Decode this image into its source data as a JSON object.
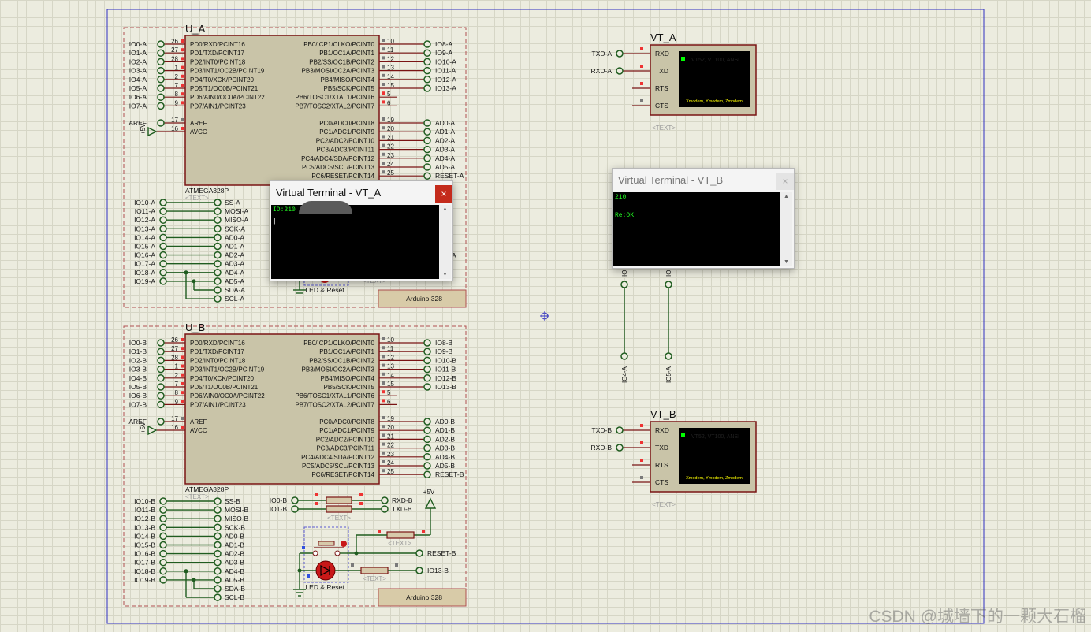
{
  "window": {
    "title": "Virtual Terminal - VT_A",
    "close_glyph": "×"
  },
  "colors": {
    "wire": "#1f5c1f",
    "chip_fill": "#c9c4a8",
    "chip_border": "#7a1414",
    "dash": "#b05050",
    "sheet_border": "#3030c0",
    "pin_red": "#e33",
    "pin_gray": "#7a7a7a"
  },
  "chip_a": {
    "ref": "U_A",
    "part": "ATMEGA328P",
    "text": "<TEXT>",
    "left_pins": [
      {
        "num": "26",
        "name": "PD0/RXD/PCINT16",
        "net": "IO0-A"
      },
      {
        "num": "27",
        "name": "PD1/TXD/PCINT17",
        "net": "IO1-A"
      },
      {
        "num": "28",
        "name": "PD2/INT0/PCINT18",
        "net": "IO2-A"
      },
      {
        "num": "1",
        "name": "PD3/INT1/OC2B/PCINT19",
        "net": "IO3-A"
      },
      {
        "num": "2",
        "name": "PD4/T0/XCK/PCINT20",
        "net": "IO4-A"
      },
      {
        "num": "7",
        "name": "PD5/T1/OC0B/PCINT21",
        "net": "IO5-A"
      },
      {
        "num": "8",
        "name": "PD6/AIN0/OC0A/PCINT22",
        "net": "IO6-A"
      },
      {
        "num": "9",
        "name": "PD7/AIN1/PCINT23",
        "net": "IO7-A"
      }
    ],
    "aref": {
      "num": "17",
      "name": "AREF",
      "net": "AREF"
    },
    "avcc": {
      "num": "16",
      "name": "AVCC",
      "net": "+5V"
    },
    "right_top": [
      {
        "num": "10",
        "name": "PB0/ICP1/CLKO/PCINT0",
        "net": "IO8-A"
      },
      {
        "num": "11",
        "name": "PB1/OC1A/PCINT1",
        "net": "IO9-A"
      },
      {
        "num": "12",
        "name": "PB2/SS/OC1B/PCINT2",
        "net": "IO10-A"
      },
      {
        "num": "13",
        "name": "PB3/MOSI/OC2A/PCINT3",
        "net": "IO11-A"
      },
      {
        "num": "14",
        "name": "PB4/MISO/PCINT4",
        "net": "IO12-A"
      },
      {
        "num": "15",
        "name": "PB5/SCK/PCINT5",
        "net": "IO13-A"
      },
      {
        "num": "5",
        "name": "PB6/TOSC1/XTAL1/PCINT6",
        "net": ""
      },
      {
        "num": "6",
        "name": "PB7/TOSC2/XTAL2/PCINT7",
        "net": ""
      }
    ],
    "right_bottom": [
      {
        "num": "19",
        "name": "PC0/ADC0/PCINT8",
        "net": "AD0-A"
      },
      {
        "num": "20",
        "name": "PC1/ADC1/PCINT9",
        "net": "AD1-A"
      },
      {
        "num": "21",
        "name": "PC2/ADC2/PCINT10",
        "net": "AD2-A"
      },
      {
        "num": "22",
        "name": "PC3/ADC3/PCINT11",
        "net": "AD3-A"
      },
      {
        "num": "23",
        "name": "PC4/ADC4/SDA/PCINT12",
        "net": "AD4-A"
      },
      {
        "num": "24",
        "name": "PC5/ADC5/SCL/PCINT13",
        "net": "AD5-A"
      },
      {
        "num": "25",
        "name": "PC6/RESET/PCINT14",
        "net": "RESET-A"
      }
    ],
    "header": [
      [
        "IO10-A",
        "SS-A"
      ],
      [
        "IO11-A",
        "MOSI-A"
      ],
      [
        "IO12-A",
        "MISO-A"
      ],
      [
        "IO13-A",
        "SCK-A"
      ],
      [
        "IO14-A",
        "AD0-A"
      ],
      [
        "IO15-A",
        "AD1-A"
      ],
      [
        "IO16-A",
        "AD2-A"
      ],
      [
        "IO17-A",
        "AD3-A"
      ],
      [
        "IO18-A",
        "AD4-A"
      ],
      [
        "IO19-A",
        "AD5-A"
      ],
      [
        "",
        "SDA-A"
      ],
      [
        "",
        "SCL-A"
      ]
    ],
    "board": "Arduino 328",
    "led_reset": "LED & Reset",
    "partial_net": "A",
    "text2": "<TEXT>"
  },
  "chip_b": {
    "ref": "U_B",
    "part": "ATMEGA328P",
    "text": "<TEXT>",
    "left_pins": [
      {
        "num": "26",
        "name": "PD0/RXD/PCINT16",
        "net": "IO0-B"
      },
      {
        "num": "27",
        "name": "PD1/TXD/PCINT17",
        "net": "IO1-B"
      },
      {
        "num": "28",
        "name": "PD2/INT0/PCINT18",
        "net": "IO2-B"
      },
      {
        "num": "1",
        "name": "PD3/INT1/OC2B/PCINT19",
        "net": "IO3-B"
      },
      {
        "num": "2",
        "name": "PD4/T0/XCK/PCINT20",
        "net": "IO4-B"
      },
      {
        "num": "7",
        "name": "PD5/T1/OC0B/PCINT21",
        "net": "IO5-B"
      },
      {
        "num": "8",
        "name": "PD6/AIN0/OC0A/PCINT22",
        "net": "IO6-B"
      },
      {
        "num": "9",
        "name": "PD7/AIN1/PCINT23",
        "net": "IO7-B"
      }
    ],
    "aref": {
      "num": "17",
      "name": "AREF",
      "net": "AREF"
    },
    "avcc": {
      "num": "16",
      "name": "AVCC",
      "net": "+5V"
    },
    "right_top": [
      {
        "num": "10",
        "name": "PB0/ICP1/CLKO/PCINT0",
        "net": "IO8-B"
      },
      {
        "num": "11",
        "name": "PB1/OC1A/PCINT1",
        "net": "IO9-B"
      },
      {
        "num": "12",
        "name": "PB2/SS/OC1B/PCINT2",
        "net": "IO10-B"
      },
      {
        "num": "13",
        "name": "PB3/MOSI/OC2A/PCINT3",
        "net": "IO11-B"
      },
      {
        "num": "14",
        "name": "PB4/MISO/PCINT4",
        "net": "IO12-B"
      },
      {
        "num": "15",
        "name": "PB5/SCK/PCINT5",
        "net": "IO13-B"
      },
      {
        "num": "5",
        "name": "PB6/TOSC1/XTAL1/PCINT6",
        "net": ""
      },
      {
        "num": "6",
        "name": "PB7/TOSC2/XTAL2/PCINT7",
        "net": ""
      }
    ],
    "right_bottom": [
      {
        "num": "19",
        "name": "PC0/ADC0/PCINT8",
        "net": "AD0-B"
      },
      {
        "num": "20",
        "name": "PC1/ADC1/PCINT9",
        "net": "AD1-B"
      },
      {
        "num": "21",
        "name": "PC2/ADC2/PCINT10",
        "net": "AD2-B"
      },
      {
        "num": "22",
        "name": "PC3/ADC3/PCINT11",
        "net": "AD3-B"
      },
      {
        "num": "23",
        "name": "PC4/ADC4/SDA/PCINT12",
        "net": "AD4-B"
      },
      {
        "num": "24",
        "name": "PC5/ADC5/SCL/PCINT13",
        "net": "AD5-B"
      },
      {
        "num": "25",
        "name": "PC6/RESET/PCINT14",
        "net": "RESET-B"
      }
    ],
    "header": [
      [
        "IO10-B",
        "SS-B"
      ],
      [
        "IO11-B",
        "MOSI-B"
      ],
      [
        "IO12-B",
        "MISO-B"
      ],
      [
        "IO13-B",
        "SCK-B"
      ],
      [
        "IO14-B",
        "AD0-B"
      ],
      [
        "IO15-B",
        "AD1-B"
      ],
      [
        "IO16-B",
        "AD2-B"
      ],
      [
        "IO17-B",
        "AD3-B"
      ],
      [
        "IO18-B",
        "AD4-B"
      ],
      [
        "IO19-B",
        "AD5-B"
      ],
      [
        "",
        "SDA-B"
      ],
      [
        "",
        "SCL-B"
      ]
    ],
    "board": "Arduino 328",
    "led_reset": "LED & Reset",
    "serial": [
      [
        "IO0-B",
        "RXD-B"
      ],
      [
        "IO1-B",
        "TXD-B"
      ]
    ],
    "vcc": "+5V",
    "reset_net": "RESET-B",
    "led_net": "IO13-B",
    "text2": "<TEXT>"
  },
  "vt_a": {
    "ref": "VT_A",
    "pins": [
      "RXD",
      "TXD",
      "RTS",
      "CTS"
    ],
    "nets": [
      "TXD-A",
      "RXD-A"
    ],
    "screen_line1": "VT52, VT100, ANSI",
    "screen_line2": "Xmodem, Ymodem, Zmodem",
    "text": "<TEXT>"
  },
  "vt_b": {
    "ref": "VT_B",
    "pins": [
      "RXD",
      "TXD",
      "RTS",
      "CTS"
    ],
    "nets": [
      "TXD-B",
      "RXD-B"
    ],
    "screen_line1": "VT52, VT100, ANSI",
    "screen_line2": "Xmodem, Ymodem, Zmodem",
    "text": "<TEXT>"
  },
  "io_pins": [
    {
      "top": "IO",
      "bottom": "IO4-A"
    },
    {
      "top": "IO",
      "bottom": "IO5-A"
    }
  ],
  "terminal_a": {
    "title": "Virtual Terminal - VT_A",
    "close": "×",
    "line1": "ID:210",
    "line2": "|"
  },
  "terminal_b": {
    "title": "Virtual Terminal - VT_B",
    "close": "×",
    "line1": "210",
    "line2": "Re:OK"
  },
  "watermark": "CSDN @城墙下的一颗大石榴"
}
